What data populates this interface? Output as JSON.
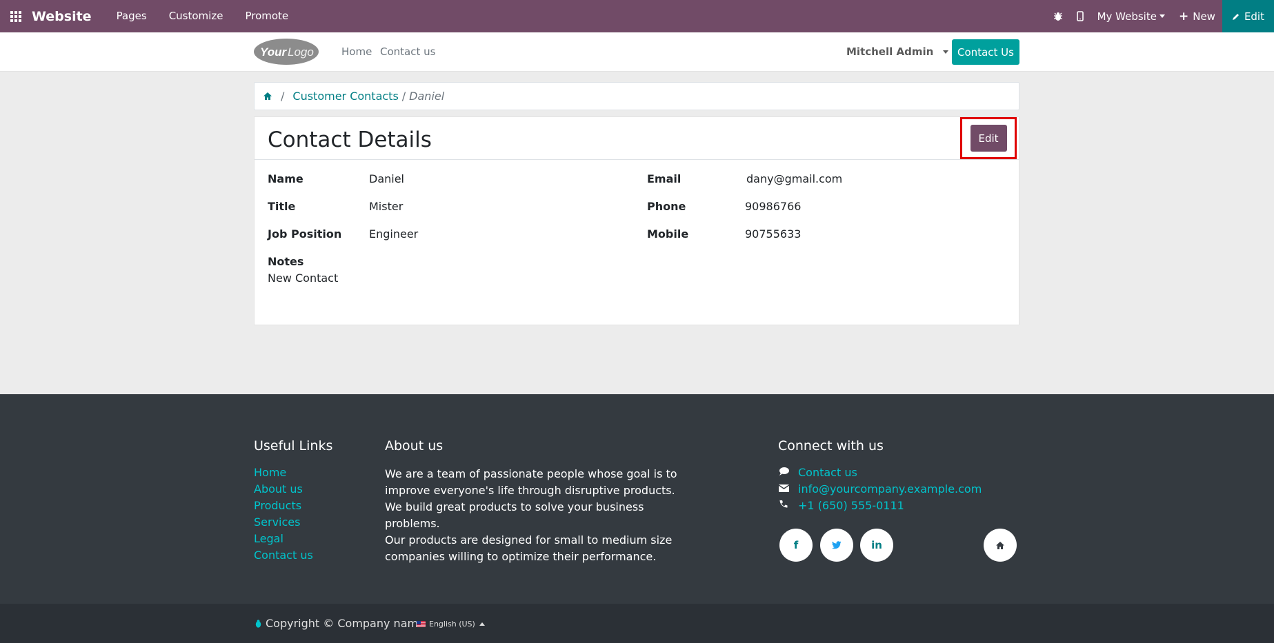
{
  "adminbar": {
    "brand": "Website",
    "menus": [
      "Pages",
      "Customize",
      "Promote"
    ],
    "my_website": "My Website",
    "new_label": "New",
    "edit_label": "Edit"
  },
  "header": {
    "logo_text": "YourLogo",
    "nav": [
      "Home",
      "Contact us"
    ],
    "user": "Mitchell Admin",
    "cta": "Contact Us"
  },
  "breadcrumb": {
    "separator": "/",
    "link": "Customer Contacts",
    "current": "Daniel"
  },
  "contact": {
    "title": "Contact Details",
    "edit_button": "Edit",
    "fields": {
      "name_label": "Name",
      "name": "Daniel",
      "title_label": "Title",
      "title": "Mister",
      "job_label": "Job Position",
      "job": "Engineer",
      "email_label": "Email",
      "email": "dany@gmail.com",
      "phone_label": "Phone",
      "phone": "90986766",
      "mobile_label": "Mobile",
      "mobile": "90755633",
      "notes_label": "Notes",
      "notes": "New Contact"
    }
  },
  "footer": {
    "useful_links_title": "Useful Links",
    "useful_links": [
      "Home",
      "About us",
      "Products",
      "Services",
      "Legal",
      "Contact us"
    ],
    "about_title": "About us",
    "about_p1": "We are a team of passionate people whose goal is to improve everyone's life through disruptive products. We build great products to solve your business problems.",
    "about_p2": "Our products are designed for small to medium size companies willing to optimize their performance.",
    "connect_title": "Connect with us",
    "connect": {
      "contact": "Contact us",
      "email": "info@yourcompany.example.com",
      "phone": "+1 (650) 555-0111"
    },
    "social_icons": [
      "facebook-icon",
      "twitter-icon",
      "linkedin-icon",
      "home-icon"
    ]
  },
  "copyright": {
    "text": "Copyright © Company name",
    "language": "English (US)"
  },
  "colors": {
    "brand_purple": "#714B67",
    "teal": "#00a09d",
    "dark_teal": "#017e84",
    "footer_bg": "#343a40",
    "highlight_red": "#e00000"
  }
}
